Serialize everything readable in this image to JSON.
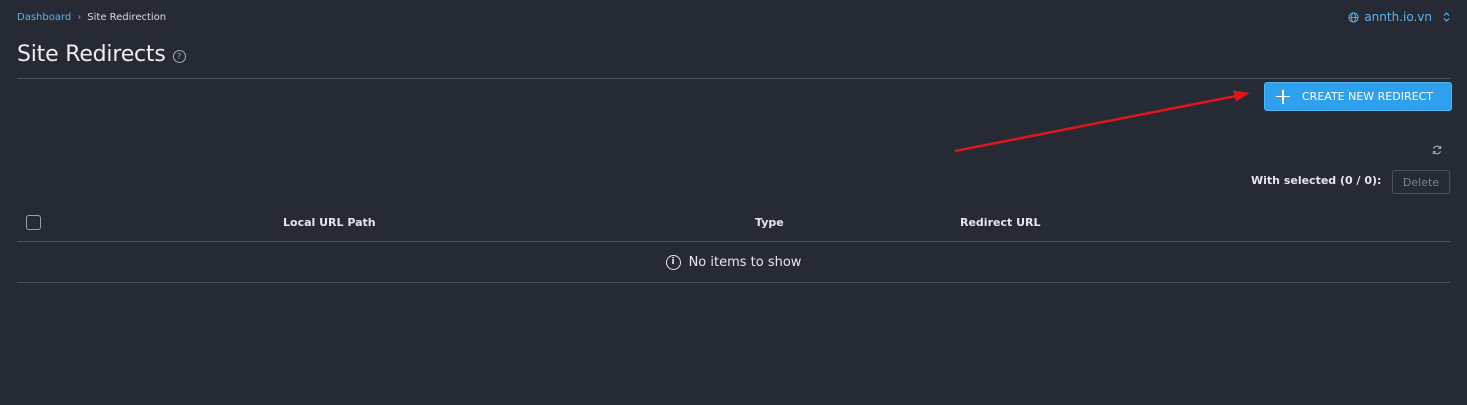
{
  "breadcrumb": {
    "home": "Dashboard",
    "separator": "›",
    "current": "Site Redirection"
  },
  "site_switcher": {
    "label": "annth.io.vn",
    "icon": "globe-icon"
  },
  "page": {
    "title": "Site Redirects",
    "help": "?"
  },
  "toolbar": {
    "create_label": "CREATE NEW REDIRECT"
  },
  "bulk": {
    "with_selected": "With selected (0 / 0):",
    "delete_label": "Delete"
  },
  "table": {
    "columns": [
      "Local URL Path",
      "Type",
      "Redirect URL"
    ],
    "empty_icon": "i",
    "empty_text": "No items to show"
  },
  "colors": {
    "accent": "#2ea0ee",
    "link": "#5fb3f0",
    "background": "#262a34",
    "annotation_arrow": "#e0141b"
  }
}
